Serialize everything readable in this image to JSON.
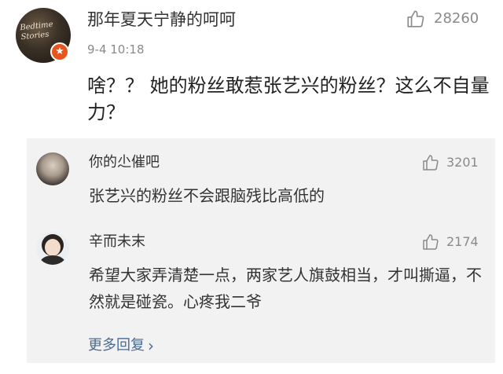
{
  "main_comment": {
    "username": "那年夏天宁静的呵呵",
    "time": "9-4 10:18",
    "likes": "28260",
    "content": "啥？？ 她的粉丝敢惹张艺兴的粉丝？这么不自量力？",
    "avatar_text": "Bedtime\nStories",
    "badge_icon": "verified-badge-icon"
  },
  "replies": [
    {
      "username": "你的尐催吧",
      "likes": "3201",
      "content": "张艺兴的粉丝不会跟脑残比高低的"
    },
    {
      "username": "辛而未末",
      "likes": "2174",
      "content": "希望大家弄清楚一点，两家艺人旗鼓相当，才叫撕逼，不然就是碰瓷。心疼我二爷"
    }
  ],
  "more_replies": {
    "label": "更多回复"
  },
  "colors": {
    "link": "#4a6b93",
    "muted": "#8a8a8a",
    "reply_bg": "#f2f2f2",
    "badge": "#e8541e"
  }
}
